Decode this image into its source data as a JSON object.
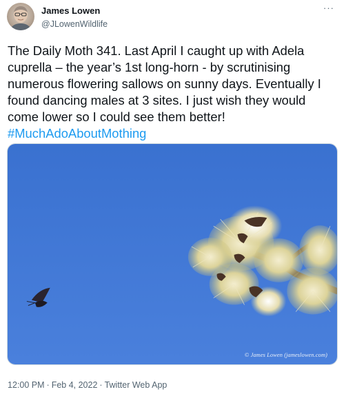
{
  "author": {
    "display_name": "James Lowen",
    "handle": "@JLowenWildlife"
  },
  "more_label": "···",
  "tweet": {
    "text": "The Daily Moth 341. Last April I caught up with Adela cuprella – the year’s 1st long-horn - by scrutinising numerous flowering sallows on sunny days. Eventually I found dancing males at 3 sites. I just wish they would come lower so I could see them better!",
    "hashtag": "#MuchAdoAboutMothing"
  },
  "media": {
    "watermark": "© James Lowen (jameslowen.com)",
    "sky_color": "#3f76d4"
  },
  "meta": {
    "time": "12:00 PM",
    "date": "Feb 4, 2022",
    "source": "Twitter Web App",
    "separator": "·"
  }
}
